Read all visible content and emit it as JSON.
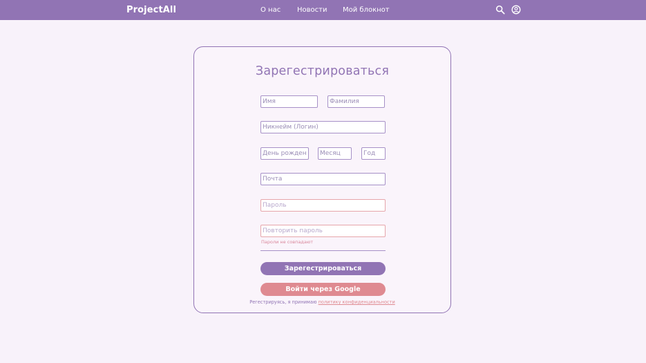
{
  "header": {
    "logo": "ProjectAll",
    "nav": [
      "О нас",
      "Новости",
      "Мой блокнот"
    ],
    "icons": [
      "search-icon",
      "account-icon"
    ]
  },
  "form": {
    "title": "Зарегестрироваться",
    "fields": {
      "first_name": {
        "placeholder": "Имя",
        "value": ""
      },
      "last_name": {
        "placeholder": "Фамилия",
        "value": ""
      },
      "nickname": {
        "placeholder": "Никнейм (Логин)",
        "value": ""
      },
      "birth_day": {
        "placeholder": "День рождения",
        "value": ""
      },
      "birth_month": {
        "placeholder": "Месяц",
        "value": ""
      },
      "birth_year": {
        "placeholder": "Год",
        "value": ""
      },
      "email": {
        "placeholder": "Почта",
        "value": ""
      },
      "password": {
        "placeholder": "Пароль",
        "value": ""
      },
      "password_repeat": {
        "placeholder": "Повторить пароль",
        "value": ""
      }
    },
    "error": "Пароли не совпадают",
    "register_button": "Зарегестрироваться",
    "google_button": "Войти через Google",
    "policy_text": "Регестрируясь, я принимаю",
    "policy_link": "политику конфиденциальности"
  },
  "colors": {
    "primary": "#9174b4",
    "accent": "#df8a91",
    "background": "#f8f2fa",
    "card": "#faf4fb"
  }
}
